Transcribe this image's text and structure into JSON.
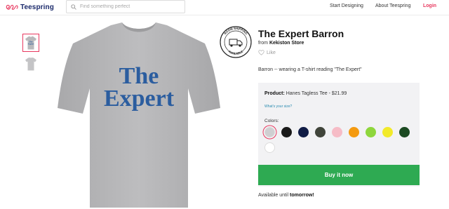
{
  "header": {
    "brand": "Teespring",
    "search_placeholder": "Find something perfect",
    "nav": {
      "start_designing": "Start Designing",
      "about": "About Teespring",
      "login": "Login"
    }
  },
  "colors": {
    "brand_pink": "#e8385f",
    "brand_navy": "#1b2a6b",
    "buy_green": "#2eaa52",
    "print_blue": "#2b5d9f"
  },
  "gallery": {
    "thumb_front_text": "The Expert"
  },
  "shirt_print": {
    "line1": "The",
    "line2": "Expert"
  },
  "badge": {
    "text_top": "ROOM SHIPPING",
    "text_bottom": "AVAILABLE"
  },
  "product": {
    "title": "The Expert Barron",
    "from_label": "from",
    "store": "Kekiston Store",
    "like_label": "Like",
    "description": "Barron -- wearing a T-shirt reading \"The Expert\"",
    "product_label": "Product:",
    "product_value": "Hanes Tagless Tee - $21.99",
    "size_link": "What's your size?",
    "colors_label": "Colors:",
    "color_swatches": [
      {
        "name": "heather-grey",
        "hex": "#cfcfd1",
        "selected": true
      },
      {
        "name": "black",
        "hex": "#1a1a1a",
        "selected": false
      },
      {
        "name": "navy",
        "hex": "#101c45",
        "selected": false
      },
      {
        "name": "charcoal",
        "hex": "#40443a",
        "selected": false
      },
      {
        "name": "light-pink",
        "hex": "#f6bcc6",
        "selected": false
      },
      {
        "name": "orange",
        "hex": "#f49a0f",
        "selected": false
      },
      {
        "name": "lime",
        "hex": "#8ed63c",
        "selected": false
      },
      {
        "name": "yellow",
        "hex": "#f2ea2a",
        "selected": false
      },
      {
        "name": "forest-green",
        "hex": "#1c4a22",
        "selected": false
      },
      {
        "name": "white",
        "hex": "#ffffff",
        "selected": false
      }
    ],
    "buy_label": "Buy it now",
    "availability_prefix": "Available until",
    "availability_value": "tomorrow!"
  }
}
